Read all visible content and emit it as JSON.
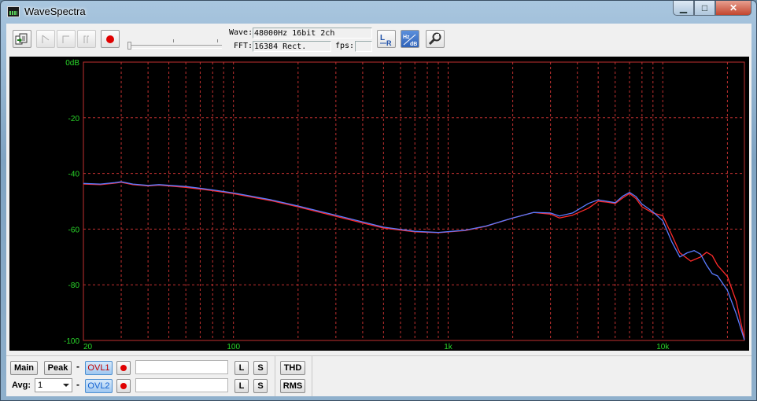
{
  "window": {
    "title": "WaveSpectra",
    "minimize_label": "▁",
    "maximize_label": "□",
    "close_label": "✕"
  },
  "toolbar": {
    "buttons": [
      "open-file",
      "play",
      "stop",
      "pause",
      "record"
    ],
    "wave_label": "Wave:",
    "wave_value": "48000Hz 16bit 2ch",
    "fft_label": "FFT:",
    "fft_value": "16384 Rect.",
    "fps_label": "fps:",
    "fps_value": "",
    "right_icons": [
      "lr-channel-icon",
      "hz-db-scale-icon",
      "settings-wrench-icon"
    ]
  },
  "bottom": {
    "main_label": "Main",
    "peak_label": "Peak",
    "dash": "-",
    "ovl1_label": "OVL1",
    "ovl2_label": "OVL2",
    "l_label": "L",
    "s_label": "S",
    "avg_label": "Avg:",
    "avg_value": "1",
    "thd_label": "THD",
    "rms_label": "RMS",
    "ovl1_text": "",
    "ovl2_text": ""
  },
  "colors": {
    "grid": "#c03030",
    "tick_text": "#29d629",
    "series_red": "#ff2a2a",
    "series_blue": "#5a7bff",
    "plot_bg": "#000000"
  },
  "chart_data": {
    "type": "line",
    "title": "",
    "xlabel": "",
    "ylabel": "",
    "x_scale": "log",
    "xlim": [
      20,
      24000
    ],
    "ylim": [
      -100,
      0
    ],
    "x_ticks": [
      {
        "value": 20,
        "label": "20"
      },
      {
        "value": 100,
        "label": "100"
      },
      {
        "value": 1000,
        "label": "1k"
      },
      {
        "value": 10000,
        "label": "10k"
      }
    ],
    "y_ticks": [
      {
        "value": 0,
        "label": "0dB"
      },
      {
        "value": -20,
        "label": "-20"
      },
      {
        "value": -40,
        "label": "-40"
      },
      {
        "value": -60,
        "label": "-60"
      },
      {
        "value": -80,
        "label": "-80"
      },
      {
        "value": -100,
        "label": "-100"
      }
    ],
    "grid": true,
    "series": [
      {
        "color": "red",
        "points": [
          [
            20,
            -43.8
          ],
          [
            24,
            -44.0
          ],
          [
            28,
            -43.5
          ],
          [
            30,
            -43.2
          ],
          [
            34,
            -44.0
          ],
          [
            40,
            -44.5
          ],
          [
            45,
            -44.2
          ],
          [
            60,
            -45.0
          ],
          [
            80,
            -46.2
          ],
          [
            100,
            -47.3
          ],
          [
            150,
            -49.8
          ],
          [
            200,
            -52.0
          ],
          [
            300,
            -55.4
          ],
          [
            400,
            -57.8
          ],
          [
            500,
            -59.6
          ],
          [
            700,
            -61.0
          ],
          [
            900,
            -61.3
          ],
          [
            1200,
            -60.5
          ],
          [
            1500,
            -59.0
          ],
          [
            2000,
            -56.0
          ],
          [
            2500,
            -54.0
          ],
          [
            3000,
            -54.6
          ],
          [
            3300,
            -56.0
          ],
          [
            3800,
            -55.0
          ],
          [
            4500,
            -52.5
          ],
          [
            5000,
            -50.0
          ],
          [
            5500,
            -50.3
          ],
          [
            6000,
            -50.8
          ],
          [
            6500,
            -48.8
          ],
          [
            7000,
            -47.2
          ],
          [
            7500,
            -49.0
          ],
          [
            8000,
            -52.0
          ],
          [
            9000,
            -54.2
          ],
          [
            10000,
            -55.2
          ],
          [
            11000,
            -62.0
          ],
          [
            12000,
            -68.5
          ],
          [
            13500,
            -71.5
          ],
          [
            15000,
            -70.0
          ],
          [
            16000,
            -68.3
          ],
          [
            17000,
            -69.5
          ],
          [
            18000,
            -73.0
          ],
          [
            20000,
            -77.0
          ],
          [
            22000,
            -86.0
          ],
          [
            24000,
            -99.5
          ]
        ]
      },
      {
        "color": "blue",
        "points": [
          [
            20,
            -43.6
          ],
          [
            24,
            -43.8
          ],
          [
            28,
            -43.3
          ],
          [
            30,
            -43.0
          ],
          [
            34,
            -43.8
          ],
          [
            40,
            -44.3
          ],
          [
            45,
            -44.0
          ],
          [
            60,
            -44.7
          ],
          [
            80,
            -45.9
          ],
          [
            100,
            -47.0
          ],
          [
            150,
            -49.5
          ],
          [
            200,
            -51.7
          ],
          [
            300,
            -55.0
          ],
          [
            400,
            -57.4
          ],
          [
            500,
            -59.3
          ],
          [
            700,
            -60.8
          ],
          [
            900,
            -61.2
          ],
          [
            1200,
            -60.4
          ],
          [
            1500,
            -58.9
          ],
          [
            2000,
            -56.0
          ],
          [
            2500,
            -54.0
          ],
          [
            3000,
            -54.2
          ],
          [
            3300,
            -55.3
          ],
          [
            3800,
            -54.2
          ],
          [
            4500,
            -50.8
          ],
          [
            5000,
            -49.5
          ],
          [
            5500,
            -50.0
          ],
          [
            6000,
            -50.5
          ],
          [
            6500,
            -48.2
          ],
          [
            7000,
            -46.8
          ],
          [
            7500,
            -48.3
          ],
          [
            8000,
            -51.0
          ],
          [
            9000,
            -53.8
          ],
          [
            10000,
            -57.0
          ],
          [
            11000,
            -64.5
          ],
          [
            12000,
            -70.0
          ],
          [
            13000,
            -68.5
          ],
          [
            14000,
            -67.7
          ],
          [
            15000,
            -69.0
          ],
          [
            16000,
            -73.0
          ],
          [
            17000,
            -76.0
          ],
          [
            18000,
            -76.8
          ],
          [
            20000,
            -82.0
          ],
          [
            22000,
            -90.5
          ],
          [
            24000,
            -99.8
          ]
        ]
      }
    ]
  }
}
